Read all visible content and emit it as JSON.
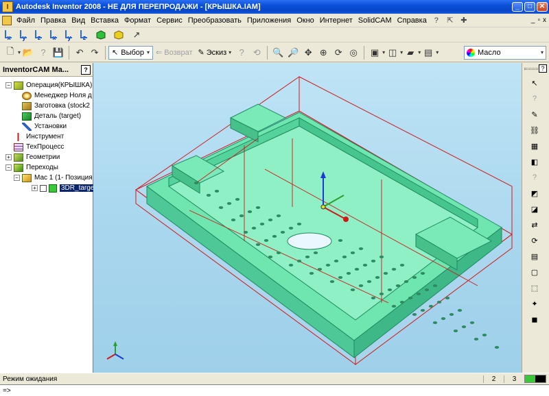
{
  "window": {
    "title": "Autodesk Inventor 2008 - НЕ ДЛЯ ПЕРЕПРОДАЖИ - [КРЫШКА.IAM]",
    "app_icon_glyph": "I",
    "controls": {
      "minimize": "_",
      "maximize": "□",
      "close": "✕"
    }
  },
  "menu": {
    "items": [
      "Файл",
      "Правка",
      "Вид",
      "Вставка",
      "Формат",
      "Сервис",
      "Преобразовать",
      "Приложения",
      "Окно",
      "Интернет",
      "SolidCAM",
      "Справка"
    ],
    "mdi": {
      "minimize": "_",
      "restore": "▫",
      "close": "x"
    }
  },
  "axis_toolbar": {
    "buttons": [
      "x",
      "y",
      "z",
      "x",
      "y",
      "z"
    ]
  },
  "main_toolbar": {
    "select_label": "Выбор",
    "return_label": "Возврат",
    "sketch_label": "Эскиз",
    "material_label": "Масло"
  },
  "left_panel": {
    "title": "InventorCAM Ма...",
    "help": "?",
    "tree": [
      {
        "label": "Операция(КРЫШКА)",
        "indent": 0,
        "expander": "−",
        "icon": "box"
      },
      {
        "label": "Менеджер Ноля д",
        "indent": 1,
        "expander": "",
        "icon": "gear"
      },
      {
        "label": "Заготовка (stock2",
        "indent": 1,
        "expander": "",
        "icon": "stock"
      },
      {
        "label": "Деталь (target)",
        "indent": 1,
        "expander": "",
        "icon": "part"
      },
      {
        "label": "Установки",
        "indent": 1,
        "expander": "",
        "icon": "wrench"
      },
      {
        "label": "Инструмент",
        "indent": 0,
        "expander": "",
        "icon": "tool"
      },
      {
        "label": "ТехПроцесс",
        "indent": 0,
        "expander": "",
        "icon": "table"
      },
      {
        "label": "Геометрии",
        "indent": 0,
        "expander": "+",
        "icon": "geom"
      },
      {
        "label": "Переходы",
        "indent": 0,
        "expander": "−",
        "icon": "moves"
      },
      {
        "label": "Мас 1 (1- Позиция",
        "indent": 1,
        "expander": "−",
        "icon": "mac"
      },
      {
        "label": "3DR_targe",
        "indent": 2,
        "expander": "+",
        "icon": "green",
        "checkbox": true,
        "selected": true
      }
    ]
  },
  "right_toolbar": {
    "help": "?",
    "icons": [
      "select-icon",
      "help-arrow-icon",
      "edit-icon",
      "chain-icon",
      "pattern-icon",
      "mirror-icon",
      "help-arrow-icon",
      "constraint-icon",
      "component-icon",
      "move-icon",
      "rotate-icon",
      "grid-icon",
      "place-icon",
      "sketch-icon",
      "point-icon",
      "box-icon"
    ]
  },
  "status": {
    "text": "Режим ожидания",
    "count1": "2",
    "count2": "3"
  },
  "command_line": {
    "text": "=>"
  },
  "colors": {
    "part_face": "#5be0a4",
    "part_edge": "#1e8a60",
    "stock_edge": "#d01818",
    "accent": "#0a246a"
  }
}
